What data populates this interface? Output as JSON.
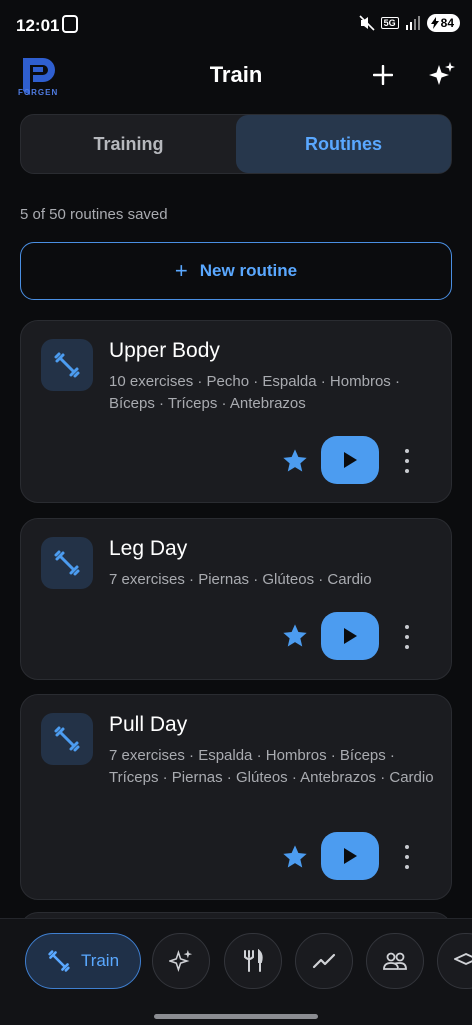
{
  "status": {
    "time": "12:01",
    "network": "5G",
    "battery": "84"
  },
  "header": {
    "brand": "FORGEN",
    "title": "Train",
    "add_icon": "plus-icon",
    "ai_icon": "sparkles-icon"
  },
  "tabs": [
    {
      "label": "Training",
      "active": false
    },
    {
      "label": "Routines",
      "active": true
    }
  ],
  "summary": "5 of 50 routines saved",
  "new_routine": {
    "label": "New routine",
    "icon": "plus-icon"
  },
  "routines": [
    {
      "name": "Upper Body",
      "meta": "10 exercises · Pecho · Espalda · Hombros · Bíceps · Tríceps · Antebrazos"
    },
    {
      "name": "Leg Day",
      "meta": "7 exercises · Piernas · Glúteos · Cardio"
    },
    {
      "name": "Pull Day",
      "meta": "7 exercises · Espalda · Hombros · Bíceps · Tríceps · Piernas · Glúteos · Antebrazos · Cardio"
    }
  ],
  "bottom_nav": [
    {
      "label": "Train",
      "icon": "dumbbell-icon",
      "active": true
    },
    {
      "label": "",
      "icon": "sparkles-icon",
      "active": false
    },
    {
      "label": "",
      "icon": "utensils-icon",
      "active": false
    },
    {
      "label": "",
      "icon": "trend-chart-icon",
      "active": false
    },
    {
      "label": "",
      "icon": "people-icon",
      "active": false
    },
    {
      "label": "",
      "icon": "graduation-cap-icon",
      "active": false
    }
  ],
  "colors": {
    "accent": "#4c9cf0",
    "background": "#0b0c0e",
    "card": "#1b1c20"
  }
}
